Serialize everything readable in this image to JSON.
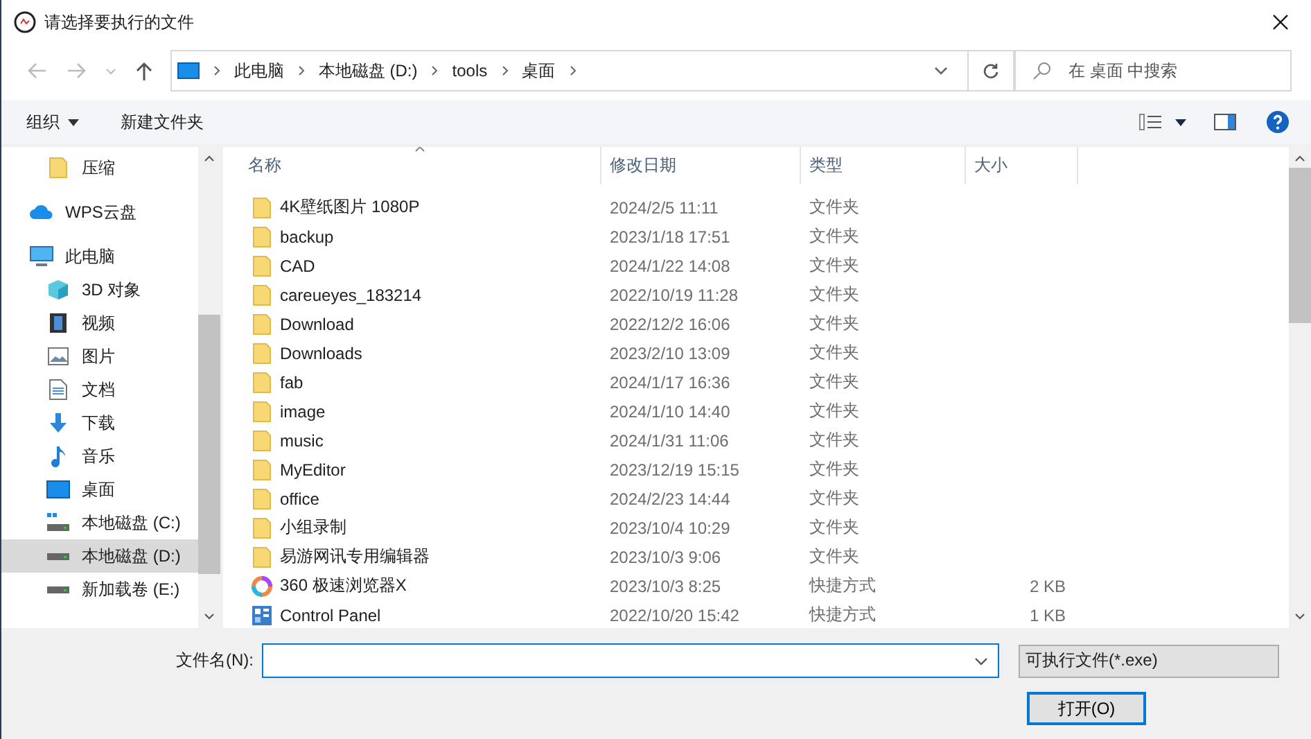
{
  "window": {
    "title": "请选择要执行的文件"
  },
  "address_bar": {
    "crumbs": [
      "此电脑",
      "本地磁盘 (D:)",
      "tools",
      "桌面"
    ]
  },
  "search": {
    "placeholder": "在 桌面 中搜索"
  },
  "toolbar": {
    "organize": "组织",
    "new_folder": "新建文件夹"
  },
  "sidebar": {
    "items": [
      {
        "kind": "folder",
        "label": "压缩",
        "selected": false
      },
      {
        "kind": "cloud",
        "label": "WPS云盘",
        "selected": false
      },
      {
        "kind": "pc",
        "label": "此电脑",
        "selected": false,
        "children": [
          {
            "kind": "cube",
            "label": "3D 对象",
            "selected": false
          },
          {
            "kind": "video",
            "label": "视频",
            "selected": false
          },
          {
            "kind": "image",
            "label": "图片",
            "selected": false
          },
          {
            "kind": "doc",
            "label": "文档",
            "selected": false
          },
          {
            "kind": "download",
            "label": "下载",
            "selected": false
          },
          {
            "kind": "music",
            "label": "音乐",
            "selected": false
          },
          {
            "kind": "desktop",
            "label": "桌面",
            "selected": false
          },
          {
            "kind": "sysdrive",
            "label": "本地磁盘 (C:)",
            "selected": false
          },
          {
            "kind": "drive",
            "label": "本地磁盘 (D:)",
            "selected": true
          },
          {
            "kind": "drive",
            "label": "新加载卷 (E:)",
            "selected": false
          }
        ]
      }
    ]
  },
  "table": {
    "columns": [
      "名称",
      "修改日期",
      "类型",
      "大小"
    ],
    "rows": [
      {
        "kind": "folder",
        "name": "4K壁纸图片 1080P",
        "date": "2024/2/5 11:11",
        "type": "文件夹"
      },
      {
        "kind": "folder",
        "name": "backup",
        "date": "2023/1/18 17:51",
        "type": "文件夹"
      },
      {
        "kind": "folder",
        "name": "CAD",
        "date": "2024/1/22 14:08",
        "type": "文件夹"
      },
      {
        "kind": "folder",
        "name": "careueyes_183214",
        "date": "2022/10/19 11:28",
        "type": "文件夹"
      },
      {
        "kind": "folder",
        "name": "Download",
        "date": "2022/12/2 16:06",
        "type": "文件夹"
      },
      {
        "kind": "folder",
        "name": "Downloads",
        "date": "2023/2/10 13:09",
        "type": "文件夹"
      },
      {
        "kind": "folder",
        "name": "fab",
        "date": "2024/1/17 16:36",
        "type": "文件夹"
      },
      {
        "kind": "folder",
        "name": "image",
        "date": "2024/1/10 14:40",
        "type": "文件夹"
      },
      {
        "kind": "folder",
        "name": "music",
        "date": "2024/1/31 11:06",
        "type": "文件夹"
      },
      {
        "kind": "folder",
        "name": "MyEditor",
        "date": "2023/12/19 15:15",
        "type": "文件夹"
      },
      {
        "kind": "folder",
        "name": "office",
        "date": "2024/2/23 14:44",
        "type": "文件夹"
      },
      {
        "kind": "folder",
        "name": "小组录制",
        "date": "2023/10/4 10:29",
        "type": "文件夹"
      },
      {
        "kind": "folder",
        "name": "易游网讯专用编辑器",
        "date": "2023/10/3 9:06",
        "type": "文件夹"
      },
      {
        "kind": "browser",
        "name": "360 极速浏览器X",
        "date": "2023/10/3 8:25",
        "type": "快捷方式",
        "size": "2 KB"
      },
      {
        "kind": "panel",
        "name": "Control Panel",
        "date": "2022/10/20 15:42",
        "type": "快捷方式",
        "size": "1 KB"
      }
    ]
  },
  "footer": {
    "filename_label": "文件名(N):",
    "file_type": "可执行文件(*.exe)",
    "open_button": "打开(O)"
  }
}
